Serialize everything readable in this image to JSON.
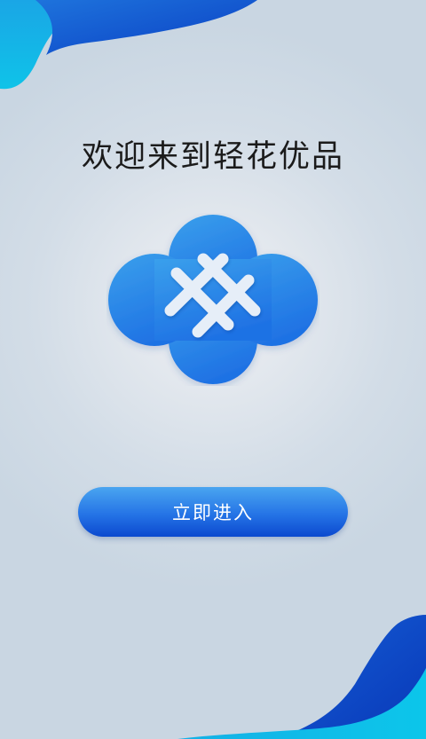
{
  "welcome": {
    "title": "欢迎来到轻花优品"
  },
  "logo": {
    "icon": "cloud-lattice-logo-icon"
  },
  "enter_button": {
    "label": "立即进入"
  },
  "colors": {
    "accent": "#2a7de8",
    "accent_dark": "#0b49cf",
    "background": "#cbd8e4",
    "title_text": "#1b1b1b",
    "button_text": "#ffffff"
  }
}
